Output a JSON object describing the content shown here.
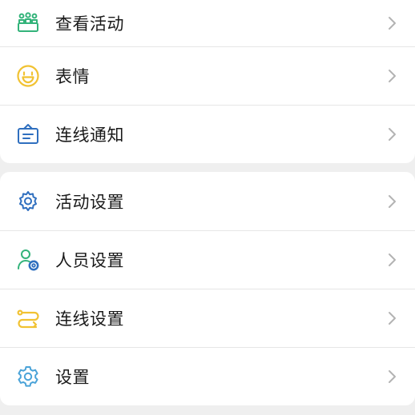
{
  "group1": {
    "items": [
      {
        "label": "查看活动",
        "icon": "crowd-icon",
        "color": "#33b37a"
      },
      {
        "label": "表情",
        "icon": "smiley-icon",
        "color": "#f1c232"
      },
      {
        "label": "连线通知",
        "icon": "notice-board-icon",
        "color": "#2f6fbf"
      }
    ]
  },
  "group2": {
    "items": [
      {
        "label": "活动设置",
        "icon": "gear-icon",
        "color": "#2f6fbf"
      },
      {
        "label": "人员设置",
        "icon": "user-settings-icon",
        "color": "#33b37a"
      },
      {
        "label": "连线设置",
        "icon": "link-route-icon",
        "color": "#f1c232"
      },
      {
        "label": "设置",
        "icon": "settings-gear-icon",
        "color": "#4aa3d8"
      }
    ]
  },
  "colors": {
    "background": "#efefef",
    "card": "#ffffff",
    "divider": "#e6e6e6",
    "chevron": "#b3b3b3"
  }
}
